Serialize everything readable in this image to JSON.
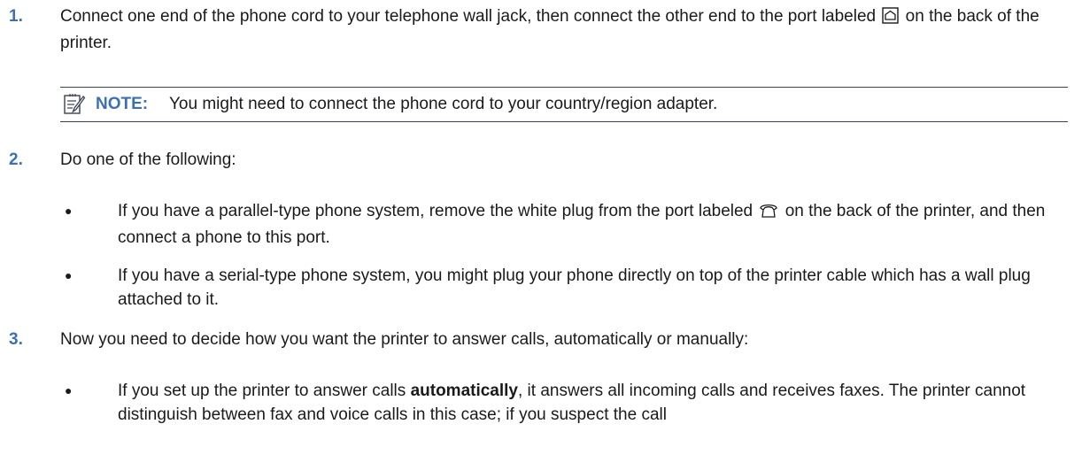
{
  "steps": [
    {
      "number": "1.",
      "text_before_icon": "Connect one end of the phone cord to your telephone wall jack, then connect the other end to the port labeled",
      "text_after_icon": "on the back of the printer."
    },
    {
      "number": "2.",
      "text": "Do one of the following:"
    },
    {
      "number": "3.",
      "text": "Now you need to decide how you want the printer to answer calls, automatically or manually:"
    }
  ],
  "note": {
    "icon": "note-pencil-icon",
    "label": "NOTE:",
    "text": "You might need to connect the phone cord to your country/region adapter."
  },
  "step2_bullets": [
    {
      "text_before_icon": "If you have a parallel-type phone system, remove the white plug from the port labeled",
      "icon": "phone-port-icon",
      "text_after_icon": "on the back of the printer, and then connect a phone to this port."
    },
    {
      "text": "If you have a serial-type phone system, you might plug your phone directly on top of the printer cable which has a wall plug attached to it."
    }
  ],
  "step3_bullets": [
    {
      "text_before_bold": "If you set up the printer to answer calls",
      "bold": "automatically",
      "text_after_bold": ", it answers all incoming calls and receives faxes. The printer cannot distinguish between fax and voice calls in this case; if you suspect the call"
    }
  ],
  "bullet_glyph": "●",
  "icons": {
    "line_port": "line-port-icon",
    "phone_port": "phone-port-icon"
  },
  "colors": {
    "accent": "#3d6fb5",
    "text": "#1a1a1a",
    "rule": "#3a4250"
  }
}
